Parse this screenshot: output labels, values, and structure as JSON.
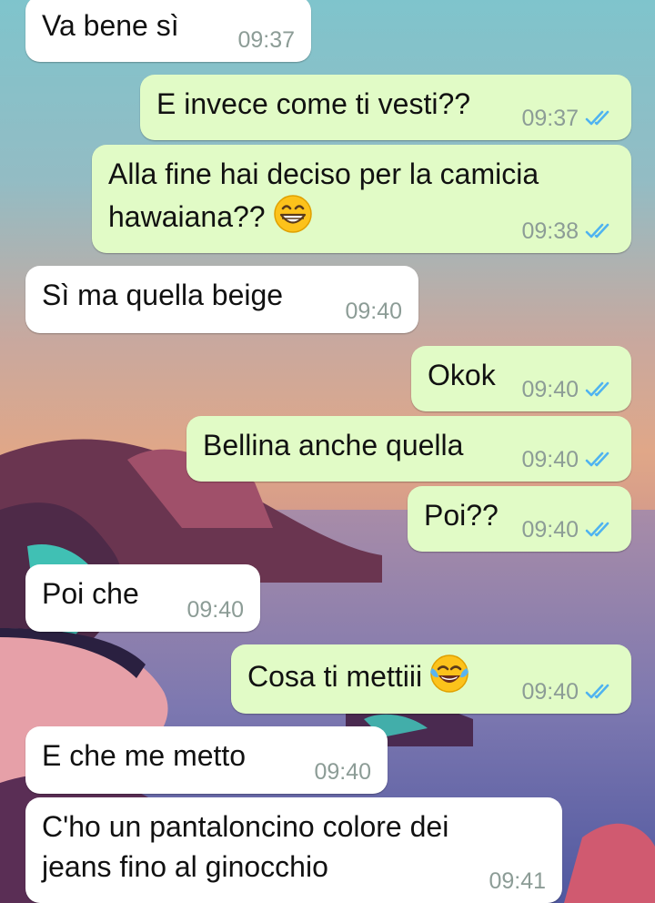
{
  "colors": {
    "incoming_bubble": "#ffffff",
    "outgoing_bubble": "#e1fbc6",
    "timestamp": "#8c9c96",
    "read_ticks": "#4fb3f0"
  },
  "messages": [
    {
      "direction": "incoming",
      "text": "Va bene sì",
      "time": "09:37"
    },
    {
      "direction": "outgoing",
      "text": "E invece come ti vesti??",
      "time": "09:37",
      "status": "read"
    },
    {
      "direction": "outgoing",
      "text": "Alla fine hai deciso per la camicia hawaiana??",
      "emoji": "grinning-face-with-smiling-eyes",
      "time": "09:38",
      "status": "read"
    },
    {
      "direction": "incoming",
      "text": "Sì ma quella beige",
      "time": "09:40"
    },
    {
      "direction": "outgoing",
      "text": "Okok",
      "time": "09:40",
      "status": "read"
    },
    {
      "direction": "outgoing",
      "text": "Bellina anche quella",
      "time": "09:40",
      "status": "read"
    },
    {
      "direction": "outgoing",
      "text": "Poi??",
      "time": "09:40",
      "status": "read"
    },
    {
      "direction": "incoming",
      "text": "Poi che",
      "time": "09:40"
    },
    {
      "direction": "outgoing",
      "text": "Cosa ti mettiii",
      "emoji": "face-with-tears-of-joy",
      "time": "09:40",
      "status": "read"
    },
    {
      "direction": "incoming",
      "text": "E che me metto",
      "time": "09:40"
    },
    {
      "direction": "incoming",
      "text": "C'ho un pantaloncino colore dei jeans fino al ginocchio",
      "time": "09:41"
    }
  ]
}
